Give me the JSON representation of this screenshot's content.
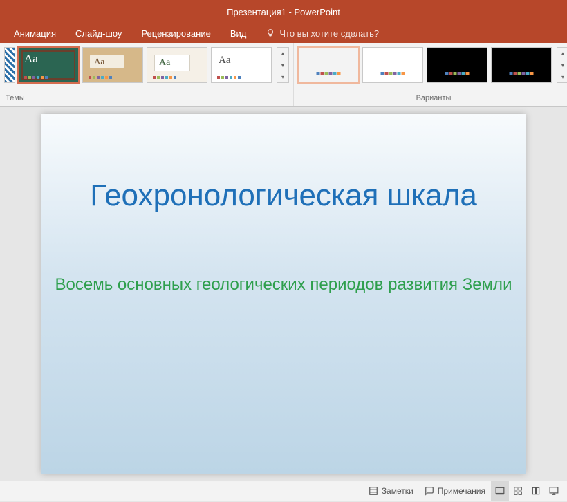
{
  "titlebar": {
    "text": "Презентация1 - PowerPoint"
  },
  "ribbon": {
    "tabs": [
      "Анимация",
      "Слайд-шоу",
      "Рецензирование",
      "Вид"
    ],
    "tell_me": "Что вы хотите сделать?"
  },
  "groups": {
    "themes_label": "Темы",
    "variants_label": "Варианты",
    "aa": "Aa"
  },
  "slide": {
    "title": "Геохронологическая шкала",
    "subtitle": "Восемь основных геологических периодов развития Земли"
  },
  "statusbar": {
    "notes": "Заметки",
    "comments": "Примечания"
  }
}
